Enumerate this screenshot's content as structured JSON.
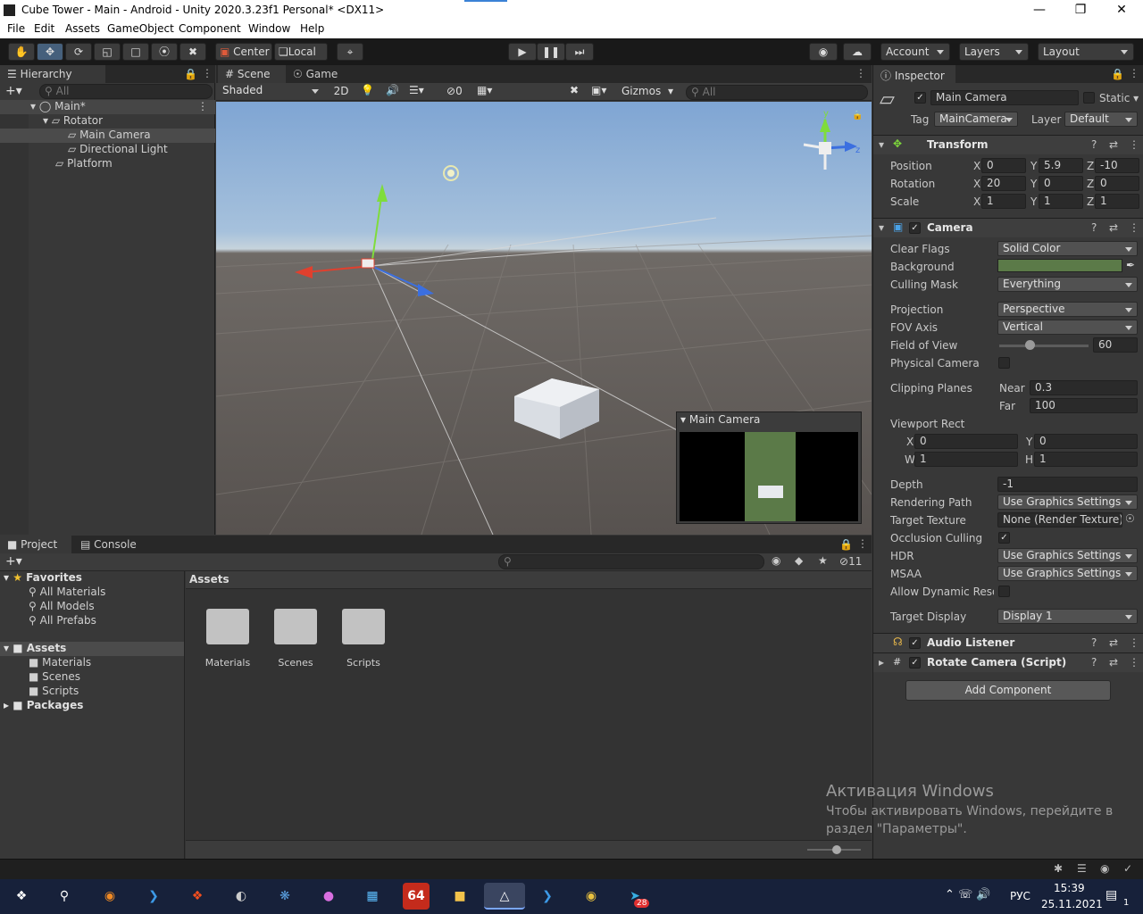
{
  "window": {
    "title": "Cube Tower - Main - Android - Unity 2020.3.23f1 Personal* <DX11>"
  },
  "menu": [
    "File",
    "Edit",
    "Assets",
    "GameObject",
    "Component",
    "Window",
    "Help"
  ],
  "toolbar": {
    "pivot": "Center",
    "space": "Local",
    "account": "Account",
    "layers": "Layers",
    "layout": "Layout"
  },
  "hierarchy": {
    "tab": "Hierarchy",
    "search_placeholder": "All",
    "items": [
      {
        "label": "Main*",
        "depth": 0
      },
      {
        "label": "Rotator",
        "depth": 1
      },
      {
        "label": "Main Camera",
        "depth": 2
      },
      {
        "label": "Directional Light",
        "depth": 2
      },
      {
        "label": "Platform",
        "depth": 1
      }
    ]
  },
  "scene": {
    "tab_scene": "Scene",
    "tab_game": "Game",
    "draw_mode": "Shaded",
    "btn_2d": "2D",
    "hidden_count": "0",
    "gizmos": "Gizmos",
    "search_placeholder": "All",
    "preview_title": "Main Camera",
    "axis_y": "y",
    "axis_z": "z"
  },
  "project": {
    "tab_project": "Project",
    "tab_console": "Console",
    "hidden_count": "11",
    "favorites_title": "Favorites",
    "favorites": [
      "All Materials",
      "All Models",
      "All Prefabs"
    ],
    "assets_title": "Assets",
    "asset_folders": [
      "Materials",
      "Scenes",
      "Scripts"
    ],
    "packages": "Packages",
    "breadcrumb": "Assets",
    "folders": [
      "Materials",
      "Scenes",
      "Scripts"
    ]
  },
  "inspector": {
    "tab": "Inspector",
    "object_name": "Main Camera",
    "static_label": "Static",
    "tag_label": "Tag",
    "tag_value": "MainCamera",
    "layer_label": "Layer",
    "layer_value": "Default",
    "transform": {
      "title": "Transform",
      "position_label": "Position",
      "pos": {
        "x": "0",
        "y": "5.9",
        "z": "-10"
      },
      "rotation_label": "Rotation",
      "rot": {
        "x": "20",
        "y": "0",
        "z": "0"
      },
      "scale_label": "Scale",
      "scale": {
        "x": "1",
        "y": "1",
        "z": "1"
      }
    },
    "camera": {
      "title": "Camera",
      "clear_flags_label": "Clear Flags",
      "clear_flags": "Solid Color",
      "background_label": "Background",
      "background_color": "#5b7a48",
      "culling_mask_label": "Culling Mask",
      "culling_mask": "Everything",
      "projection_label": "Projection",
      "projection": "Perspective",
      "fov_axis_label": "FOV Axis",
      "fov_axis": "Vertical",
      "fov_label": "Field of View",
      "fov": "60",
      "physical_label": "Physical Camera",
      "clipping_label": "Clipping Planes",
      "near_label": "Near",
      "near": "0.3",
      "far_label": "Far",
      "far": "100",
      "viewport_label": "Viewport Rect",
      "vx": "0",
      "vy": "0",
      "vw": "1",
      "vh": "1",
      "depth_label": "Depth",
      "depth": "-1",
      "rendering_path_label": "Rendering Path",
      "rendering_path": "Use Graphics Settings",
      "target_texture_label": "Target Texture",
      "target_texture": "None (Render Texture)",
      "occlusion_label": "Occlusion Culling",
      "hdr_label": "HDR",
      "hdr": "Use Graphics Settings",
      "msaa_label": "MSAA",
      "msaa": "Use Graphics Settings",
      "dynres_label": "Allow Dynamic Resol",
      "target_display_label": "Target Display",
      "target_display": "Display 1"
    },
    "audio_listener": "Audio Listener",
    "rotate_script": "Rotate Camera (Script)",
    "add_component": "Add Component"
  },
  "watermark": {
    "title": "Активация Windows",
    "line1": "Чтобы активировать Windows, перейдите в",
    "line2": "раздел \"Параметры\"."
  },
  "taskbar": {
    "lang": "РУС",
    "time": "15:39",
    "date": "25.11.2021",
    "notif": "1",
    "telegram_badge": "28",
    "aida": "64"
  }
}
